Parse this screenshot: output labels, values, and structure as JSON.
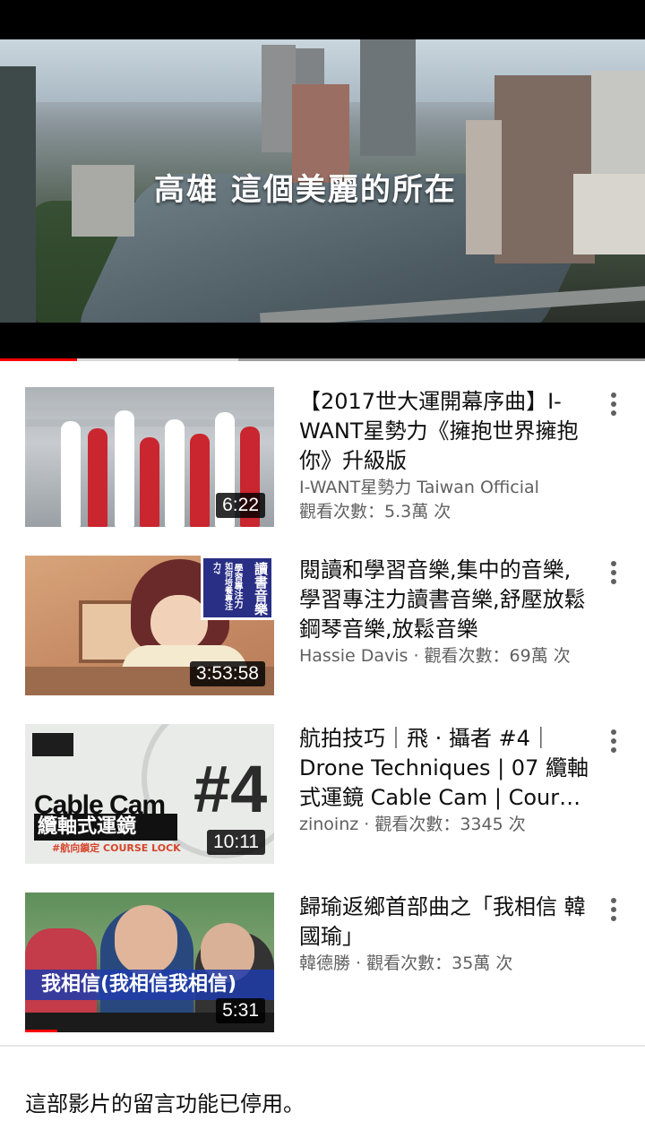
{
  "player": {
    "overlay_title": "高雄 這個美麗的所在",
    "progress_fraction": 0.12,
    "buffer_fraction": 0.37
  },
  "videos": [
    {
      "title": "【2017世大運開幕序曲】I-WANT星勢力《擁抱世界擁抱你》升級版",
      "line1": "I-WANT星勢力 Taiwan Official",
      "line2": "觀看次數：5.3萬 次",
      "duration": "6:22"
    },
    {
      "title": "閱讀和學習音樂,集中的音樂,學習專注力讀書音樂,舒壓放鬆鋼琴音樂,放鬆音樂",
      "line1": "Hassie Davis · 觀看次數：69萬 次",
      "line2": "",
      "duration": "3:53:58",
      "thumb_sign_a": "讀書音樂",
      "thumb_sign_b": "學習專注力",
      "thumb_sign_c": "如何培養專注力?"
    },
    {
      "title": "航拍技巧｜飛 · 攝者 #4｜Drone Techniques | 07 纜軸式運鏡 Cable Cam | Course Lock",
      "line1": "zinoinz · 觀看次數：3345 次",
      "line2": "",
      "duration": "10:11",
      "thumb_text_a": "Cable Cam",
      "thumb_text_b": "纜軸式運鏡",
      "thumb_text_c": "#航向鎖定 COURSE LOCK",
      "thumb_num": "#4"
    },
    {
      "title": "歸瑜返鄉首部曲之「我相信 韓國瑜」",
      "line1": "韓德勝 · 觀看次數：35萬 次",
      "line2": "",
      "duration": "5:31",
      "thumb_banner": "我相信(我相信我相信)"
    }
  ],
  "comments_disabled": "這部影片的留言功能已停用。",
  "colors": {
    "progress": "#ff0000",
    "secondary_text": "#606060",
    "duration_bg": "#000000"
  },
  "icons": {
    "menu": "vertical-ellipsis-icon"
  }
}
